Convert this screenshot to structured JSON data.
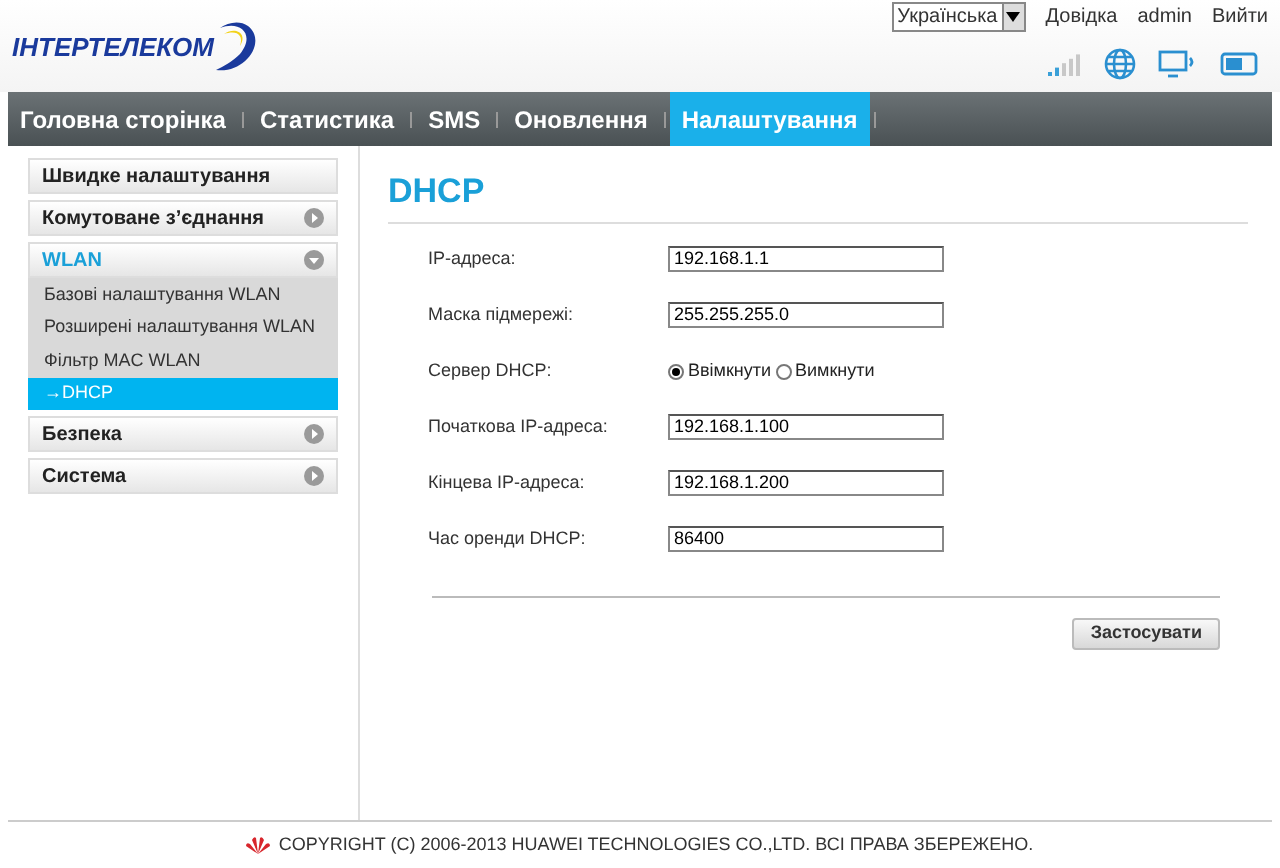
{
  "header": {
    "logo": "ІНТЕРТЕЛЕКОМ",
    "language": "Українська",
    "links": [
      "Довідка",
      "admin",
      "Вийти"
    ]
  },
  "nav": [
    {
      "label": "Головна сторінка",
      "selected": false
    },
    {
      "label": "Статистика",
      "selected": false
    },
    {
      "label": "SMS",
      "selected": false
    },
    {
      "label": "Оновлення",
      "selected": false
    },
    {
      "label": "Налаштування",
      "selected": true
    }
  ],
  "sidebar": [
    {
      "kind": "link",
      "label": "Швидке налаштування"
    },
    {
      "kind": "group",
      "label": "Комутоване з’єднання",
      "expanded": false
    },
    {
      "kind": "group",
      "label": "WLAN",
      "expanded": true,
      "children": [
        {
          "label": "Базові налаштування WLAN",
          "selected": false
        },
        {
          "label": "Розширені налаштування WLAN",
          "selected": false
        },
        {
          "label": "Фільтр MAC WLAN",
          "selected": false
        },
        {
          "label": "→DHCP",
          "selected": true
        }
      ]
    },
    {
      "kind": "group",
      "label": "Безпека",
      "expanded": false
    },
    {
      "kind": "group",
      "label": "Система",
      "expanded": false
    }
  ],
  "page": {
    "title": "DHCP",
    "fields": [
      {
        "kind": "text",
        "label": "IP-адреса:",
        "value": "192.168.1.1"
      },
      {
        "kind": "text",
        "label": "Маска підмережі:",
        "value": "255.255.255.0"
      },
      {
        "kind": "radio",
        "label": "Сервер DHCP:",
        "options": [
          {
            "label": "Ввімкнути",
            "selected": true
          },
          {
            "label": "Вимкнути",
            "selected": false
          }
        ]
      },
      {
        "kind": "text",
        "label": "Початкова IP-адреса:",
        "value": "192.168.1.100"
      },
      {
        "kind": "text",
        "label": "Кінцева IP-адреса:",
        "value": "192.168.1.200"
      },
      {
        "kind": "text",
        "label": "Час оренди DHCP:",
        "value": "86400"
      }
    ],
    "apply_button": "Застосувати"
  },
  "footer": "COPYRIGHT (C) 2006-2013 HUAWEI TECHNOLOGIES CO.,LTD. ВСІ ПРАВА ЗБЕРЕЖЕНО."
}
